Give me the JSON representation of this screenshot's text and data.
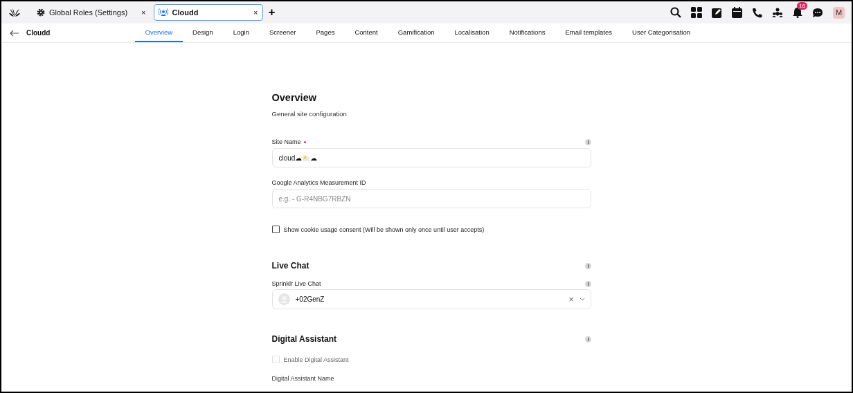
{
  "browser_tabs": [
    {
      "label": "Global Roles (Settings)",
      "kind": "settings",
      "selected": false,
      "close": "×"
    },
    {
      "label": "Cloudd",
      "kind": "site",
      "selected": true,
      "close": "×"
    }
  ],
  "new_tab": "+",
  "notifications": {
    "count": "16"
  },
  "avatar": {
    "initial": "M"
  },
  "page": {
    "title": "Cloudd"
  },
  "nav_tabs": [
    {
      "label": "Overview",
      "selected": true
    },
    {
      "label": "Design",
      "selected": false
    },
    {
      "label": "Login",
      "selected": false
    },
    {
      "label": "Screener",
      "selected": false
    },
    {
      "label": "Pages",
      "selected": false
    },
    {
      "label": "Content",
      "selected": false
    },
    {
      "label": "Gamification",
      "selected": false
    },
    {
      "label": "Localisation",
      "selected": false
    },
    {
      "label": "Notifications",
      "selected": false
    },
    {
      "label": "Email templates",
      "selected": false
    },
    {
      "label": "User Categorisation",
      "selected": false
    }
  ],
  "section": {
    "title": "Overview",
    "subtitle": "General site configuration"
  },
  "site_name": {
    "label": "Site Name",
    "required": true,
    "value": "cloud☁⛅☁"
  },
  "analytics": {
    "label": "Google Analytics Measurement ID",
    "placeholder": "e.g. - G-R4NBG7RBZN"
  },
  "cookie_consent": {
    "label": "Show cookie usage consent (Will be shown only once until user accepts)",
    "checked": false,
    "disabled": false
  },
  "live_chat": {
    "title": "Live Chat",
    "field_label": "Sprinklr Live Chat",
    "value": "+02GenZ",
    "clear": "×"
  },
  "digital_assistant": {
    "title": "Digital Assistant",
    "enable": {
      "label": "Enable Digital Assistant",
      "checked": false,
      "disabled": true
    },
    "name_label": "Digital Assistant Name"
  }
}
